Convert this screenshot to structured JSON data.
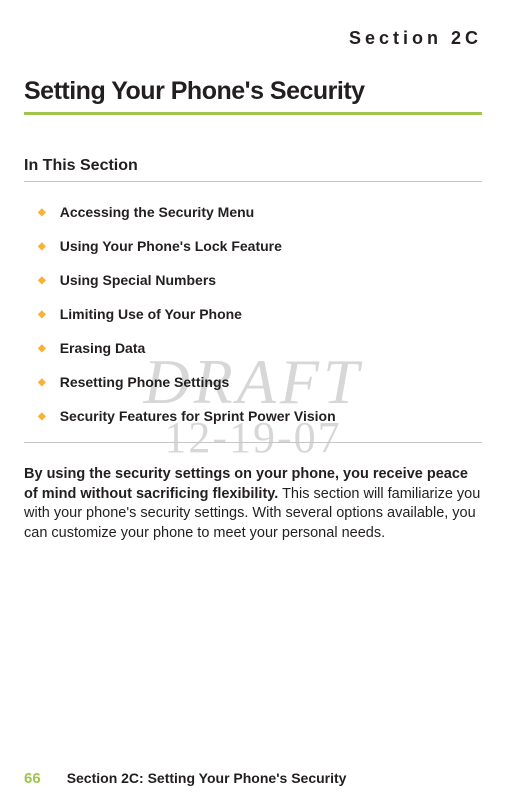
{
  "header": {
    "section_label": "Section 2C"
  },
  "title": "Setting Your Phone's Security",
  "subhead": "In This Section",
  "toc": [
    "Accessing the Security Menu",
    "Using Your Phone's Lock Feature",
    "Using Special Numbers",
    "Limiting Use of Your Phone",
    "Erasing Data",
    "Resetting Phone Settings",
    "Security Features for Sprint Power Vision"
  ],
  "body": {
    "lead": "By using the security settings on your phone, you receive peace of mind without sacrificing flexibility.",
    "rest": " This section will familiarize you with your phone's security settings. With several options available, you can customize your phone to meet your personal needs."
  },
  "watermark": {
    "line1": "DRAFT",
    "line2": "12-19-07"
  },
  "footer": {
    "page": "66",
    "text": "Section 2C: Setting Your Phone's Security"
  }
}
